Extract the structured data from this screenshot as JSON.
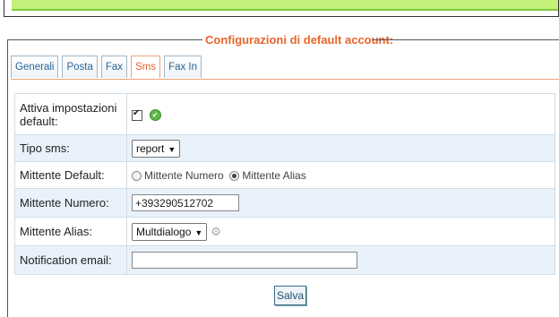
{
  "fieldset": {
    "legend": "Configurazioni di default account:"
  },
  "tabs": [
    {
      "label": "Generali",
      "active": false
    },
    {
      "label": "Posta",
      "active": false
    },
    {
      "label": "Fax",
      "active": false
    },
    {
      "label": "Sms",
      "active": true
    },
    {
      "label": "Fax In",
      "active": false
    }
  ],
  "form": {
    "attiva": {
      "label": "Attiva impostazioni default:",
      "checked": true,
      "status_icon": "check-circle-icon"
    },
    "tipo_sms": {
      "label": "Tipo sms:",
      "value": "report"
    },
    "mittente_default": {
      "label": "Mittente Default:",
      "options": [
        "Mittente Numero",
        "Mittente Alias"
      ],
      "selected": "Mittente Alias"
    },
    "mittente_numero": {
      "label": "Mittente Numero:",
      "value": "+393290512702"
    },
    "mittente_alias": {
      "label": "Mittente Alias:",
      "value": "Multdialogo",
      "settings_icon": "gear-icon"
    },
    "notification_email": {
      "label": "Notification email:",
      "value": ""
    }
  },
  "actions": {
    "save_label": "Salva"
  },
  "colors": {
    "accent": "#e8652b",
    "topbar": "#c4f07a",
    "row_alt": "#e9f2fa"
  }
}
